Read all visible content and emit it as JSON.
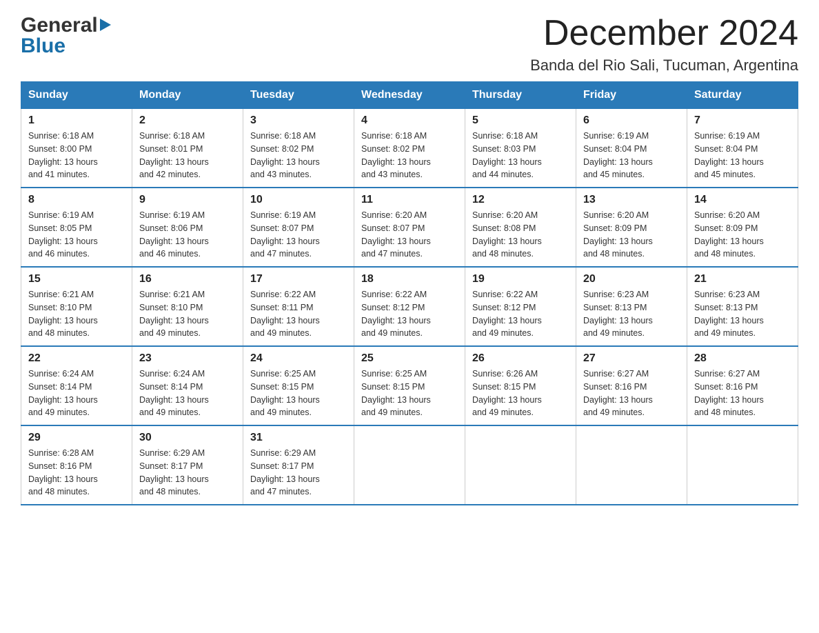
{
  "header": {
    "logo_general": "General",
    "logo_blue": "Blue",
    "title": "December 2024",
    "subtitle": "Banda del Rio Sali, Tucuman, Argentina"
  },
  "days_of_week": [
    "Sunday",
    "Monday",
    "Tuesday",
    "Wednesday",
    "Thursday",
    "Friday",
    "Saturday"
  ],
  "weeks": [
    [
      {
        "day": "1",
        "sunrise": "6:18 AM",
        "sunset": "8:00 PM",
        "daylight": "13 hours and 41 minutes."
      },
      {
        "day": "2",
        "sunrise": "6:18 AM",
        "sunset": "8:01 PM",
        "daylight": "13 hours and 42 minutes."
      },
      {
        "day": "3",
        "sunrise": "6:18 AM",
        "sunset": "8:02 PM",
        "daylight": "13 hours and 43 minutes."
      },
      {
        "day": "4",
        "sunrise": "6:18 AM",
        "sunset": "8:02 PM",
        "daylight": "13 hours and 43 minutes."
      },
      {
        "day": "5",
        "sunrise": "6:18 AM",
        "sunset": "8:03 PM",
        "daylight": "13 hours and 44 minutes."
      },
      {
        "day": "6",
        "sunrise": "6:19 AM",
        "sunset": "8:04 PM",
        "daylight": "13 hours and 45 minutes."
      },
      {
        "day": "7",
        "sunrise": "6:19 AM",
        "sunset": "8:04 PM",
        "daylight": "13 hours and 45 minutes."
      }
    ],
    [
      {
        "day": "8",
        "sunrise": "6:19 AM",
        "sunset": "8:05 PM",
        "daylight": "13 hours and 46 minutes."
      },
      {
        "day": "9",
        "sunrise": "6:19 AM",
        "sunset": "8:06 PM",
        "daylight": "13 hours and 46 minutes."
      },
      {
        "day": "10",
        "sunrise": "6:19 AM",
        "sunset": "8:07 PM",
        "daylight": "13 hours and 47 minutes."
      },
      {
        "day": "11",
        "sunrise": "6:20 AM",
        "sunset": "8:07 PM",
        "daylight": "13 hours and 47 minutes."
      },
      {
        "day": "12",
        "sunrise": "6:20 AM",
        "sunset": "8:08 PM",
        "daylight": "13 hours and 48 minutes."
      },
      {
        "day": "13",
        "sunrise": "6:20 AM",
        "sunset": "8:09 PM",
        "daylight": "13 hours and 48 minutes."
      },
      {
        "day": "14",
        "sunrise": "6:20 AM",
        "sunset": "8:09 PM",
        "daylight": "13 hours and 48 minutes."
      }
    ],
    [
      {
        "day": "15",
        "sunrise": "6:21 AM",
        "sunset": "8:10 PM",
        "daylight": "13 hours and 48 minutes."
      },
      {
        "day": "16",
        "sunrise": "6:21 AM",
        "sunset": "8:10 PM",
        "daylight": "13 hours and 49 minutes."
      },
      {
        "day": "17",
        "sunrise": "6:22 AM",
        "sunset": "8:11 PM",
        "daylight": "13 hours and 49 minutes."
      },
      {
        "day": "18",
        "sunrise": "6:22 AM",
        "sunset": "8:12 PM",
        "daylight": "13 hours and 49 minutes."
      },
      {
        "day": "19",
        "sunrise": "6:22 AM",
        "sunset": "8:12 PM",
        "daylight": "13 hours and 49 minutes."
      },
      {
        "day": "20",
        "sunrise": "6:23 AM",
        "sunset": "8:13 PM",
        "daylight": "13 hours and 49 minutes."
      },
      {
        "day": "21",
        "sunrise": "6:23 AM",
        "sunset": "8:13 PM",
        "daylight": "13 hours and 49 minutes."
      }
    ],
    [
      {
        "day": "22",
        "sunrise": "6:24 AM",
        "sunset": "8:14 PM",
        "daylight": "13 hours and 49 minutes."
      },
      {
        "day": "23",
        "sunrise": "6:24 AM",
        "sunset": "8:14 PM",
        "daylight": "13 hours and 49 minutes."
      },
      {
        "day": "24",
        "sunrise": "6:25 AM",
        "sunset": "8:15 PM",
        "daylight": "13 hours and 49 minutes."
      },
      {
        "day": "25",
        "sunrise": "6:25 AM",
        "sunset": "8:15 PM",
        "daylight": "13 hours and 49 minutes."
      },
      {
        "day": "26",
        "sunrise": "6:26 AM",
        "sunset": "8:15 PM",
        "daylight": "13 hours and 49 minutes."
      },
      {
        "day": "27",
        "sunrise": "6:27 AM",
        "sunset": "8:16 PM",
        "daylight": "13 hours and 49 minutes."
      },
      {
        "day": "28",
        "sunrise": "6:27 AM",
        "sunset": "8:16 PM",
        "daylight": "13 hours and 48 minutes."
      }
    ],
    [
      {
        "day": "29",
        "sunrise": "6:28 AM",
        "sunset": "8:16 PM",
        "daylight": "13 hours and 48 minutes."
      },
      {
        "day": "30",
        "sunrise": "6:29 AM",
        "sunset": "8:17 PM",
        "daylight": "13 hours and 48 minutes."
      },
      {
        "day": "31",
        "sunrise": "6:29 AM",
        "sunset": "8:17 PM",
        "daylight": "13 hours and 47 minutes."
      },
      null,
      null,
      null,
      null
    ]
  ],
  "labels": {
    "sunrise": "Sunrise:",
    "sunset": "Sunset:",
    "daylight": "Daylight:"
  }
}
